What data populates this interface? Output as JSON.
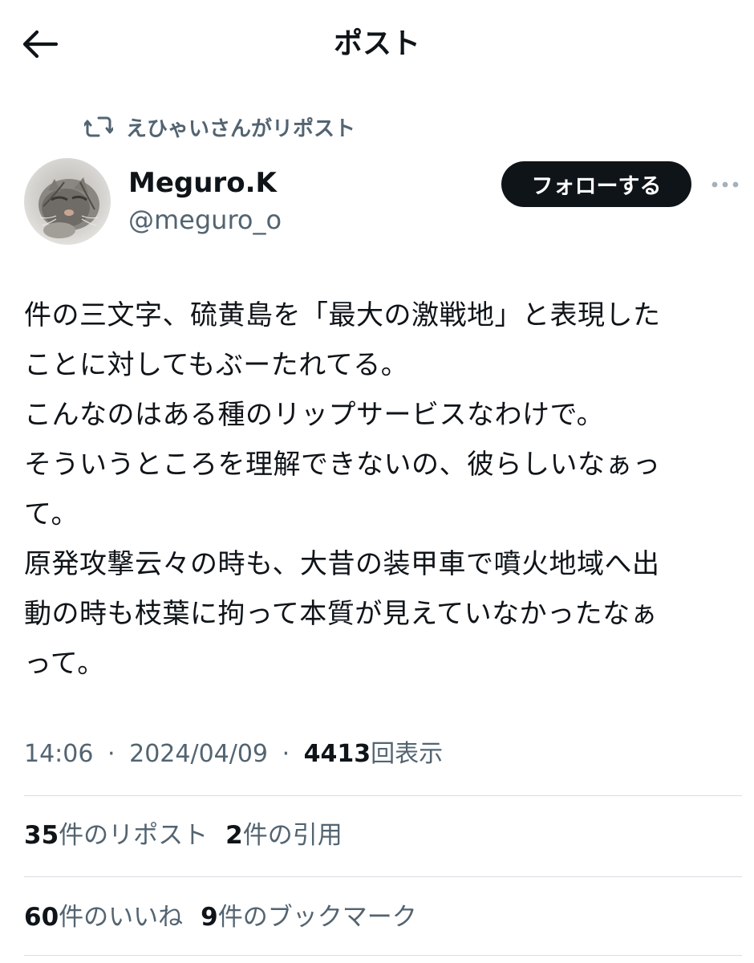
{
  "header": {
    "title": "ポスト",
    "back_icon": "arrow-left-icon"
  },
  "repost": {
    "icon": "retweet-icon",
    "label": "えひゃいさんがリポスト"
  },
  "author": {
    "name": "Meguro.K",
    "handle": "@meguro_o",
    "avatar": "cat-photo-avatar"
  },
  "follow_label": "フォローする",
  "more_icon": "more-horizontal-icon",
  "post": {
    "lines": [
      "件の三文字、硫黄島を「最大の激戦地」と表現した",
      "ことに対してもぶーたれてる。",
      "こんなのはある種のリップサービスなわけで。",
      "そういうところを理解できないの、彼らしいなぁっ",
      "て。",
      "原発攻撃云々の時も、大昔の装甲車で噴火地域へ出",
      "動の時も枝葉に拘って本質が見えていなかったなぁ",
      "って。"
    ]
  },
  "meta": {
    "time": "14:06",
    "date": "2024/04/09",
    "separator": "·",
    "views_count": "4413",
    "views_label": "回表示"
  },
  "stats": {
    "reposts_count": "35",
    "reposts_label": "件のリポスト",
    "quotes_count": "2",
    "quotes_label": "件の引用",
    "likes_count": "60",
    "likes_label": "件のいいね",
    "bookmarks_count": "9",
    "bookmarks_label": "件のブックマーク"
  },
  "colors": {
    "text_primary": "#0f1419",
    "text_secondary": "#536471",
    "divider": "#d8dde1",
    "follow_bg": "#0f1419"
  }
}
